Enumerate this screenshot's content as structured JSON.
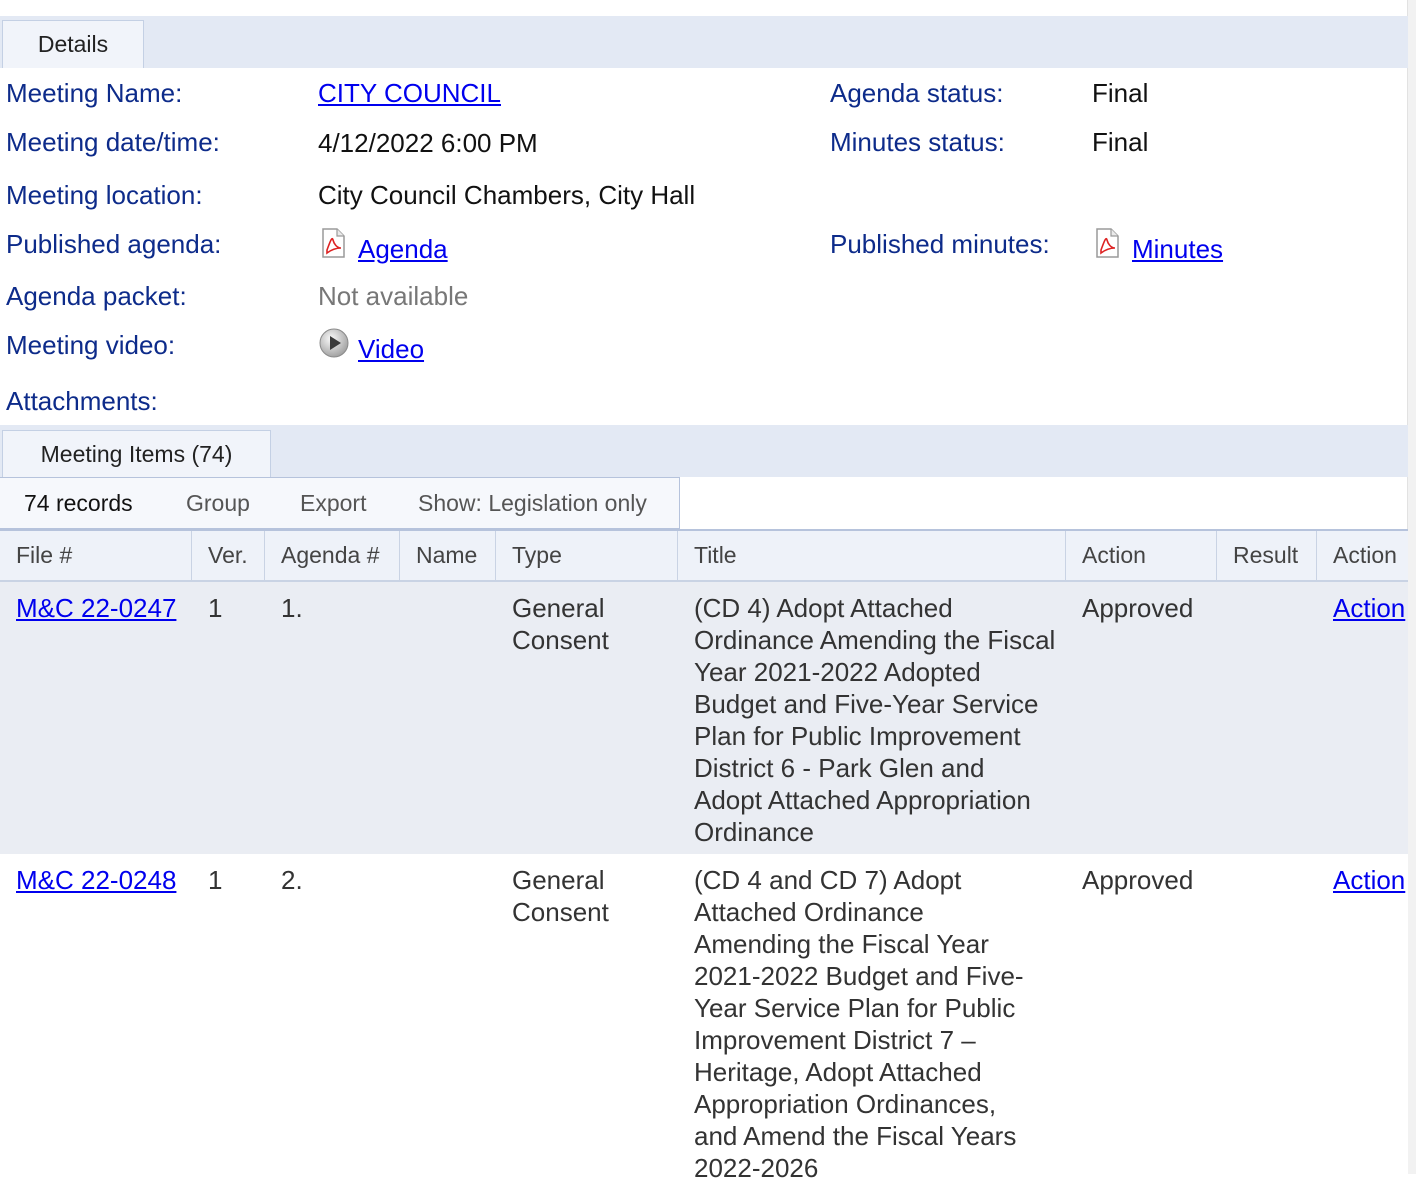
{
  "tabs": {
    "details": "Details",
    "items": "Meeting Items (74)"
  },
  "details": {
    "meeting_name_label": "Meeting Name:",
    "meeting_name_value": "CITY COUNCIL",
    "agenda_status_label": "Agenda status:",
    "agenda_status_value": "Final",
    "meeting_datetime_label": "Meeting date/time:",
    "meeting_datetime_value": "4/12/2022 6:00 PM",
    "minutes_status_label": "Minutes status:",
    "minutes_status_value": "Final",
    "meeting_location_label": "Meeting location:",
    "meeting_location_value": "City Council Chambers, City Hall",
    "published_agenda_label": "Published agenda:",
    "published_agenda_link": "Agenda",
    "published_minutes_label": "Published minutes:",
    "published_minutes_link": "Minutes",
    "agenda_packet_label": "Agenda packet:",
    "agenda_packet_value": "Not available",
    "meeting_video_label": "Meeting video:",
    "meeting_video_link": "Video",
    "attachments_label": "Attachments:"
  },
  "toolbar": {
    "records": "74 records",
    "group": "Group",
    "export": "Export",
    "show": "Show: Legislation only"
  },
  "columns": [
    "File #",
    "Ver.",
    "Agenda #",
    "Name",
    "Type",
    "Title",
    "Action",
    "Result",
    "Action"
  ],
  "rows": [
    {
      "file": "M&C 22-0247",
      "ver": "1",
      "agenda": "1.",
      "name": "",
      "type": "General Consent",
      "title": "(CD 4) Adopt Attached Ordinance Amending the Fiscal Year 2021-2022 Adopted Budget and Five-Year Service Plan for Public Improvement District 6 - Park Glen and Adopt Attached Appropriation Ordinance",
      "action": "Approved",
      "result": "",
      "action_link": "Action"
    },
    {
      "file": "M&C 22-0248",
      "ver": "1",
      "agenda": "2.",
      "name": "",
      "type": "General Consent",
      "title": "(CD 4 and CD 7) Adopt Attached Ordinance Amending the Fiscal Year 2021-2022 Budget and Five-Year Service Plan for Public Improvement District 7 – Heritage, Adopt Attached Appropriation Ordinances, and Amend the Fiscal Years 2022-2026",
      "action": "Approved",
      "result": "",
      "action_link": "Action"
    }
  ],
  "icons": {
    "pdf": "pdf-icon",
    "video": "video-play-icon"
  },
  "colors": {
    "label_blue": "#0d2b8a",
    "link_blue": "#0000ee",
    "tab_strip": "#e3e9f4",
    "odd_row": "#eaedf3"
  }
}
